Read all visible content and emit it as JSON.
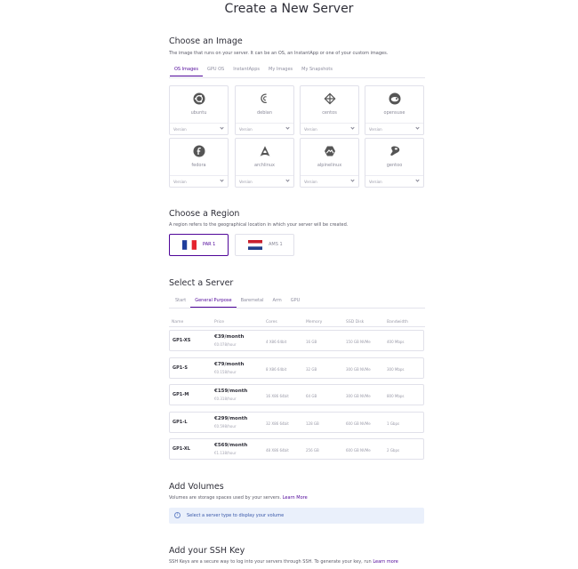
{
  "title": "Create a New Server",
  "image": {
    "heading": "Choose an Image",
    "description": "The image that runs on your server. It can be an OS, an InstantApp or one of your custom images.",
    "tabs": [
      "OS Images",
      "GPU OS",
      "InstantApps",
      "My Images",
      "My Snapshots"
    ],
    "active_tab": "OS Images",
    "os": [
      {
        "name": "ubuntu",
        "version": "Version",
        "icon": "ubuntu-icon"
      },
      {
        "name": "debian",
        "version": "Version",
        "icon": "debian-icon"
      },
      {
        "name": "centos",
        "version": "Version",
        "icon": "centos-icon"
      },
      {
        "name": "opensuse",
        "version": "Version",
        "icon": "opensuse-icon"
      },
      {
        "name": "fedora",
        "version": "Version",
        "icon": "fedora-icon"
      },
      {
        "name": "archlinux",
        "version": "Version",
        "icon": "archlinux-icon"
      },
      {
        "name": "alpinelinux",
        "version": "Version",
        "icon": "alpinelinux-icon"
      },
      {
        "name": "gentoo",
        "version": "Version",
        "icon": "gentoo-icon"
      }
    ]
  },
  "region": {
    "heading": "Choose a Region",
    "description": "A region refers to the geographical location in which your server will be created.",
    "items": [
      {
        "name": "PAR 1",
        "flag": "france-flag",
        "selected": true
      },
      {
        "name": "AMS 1",
        "flag": "netherlands-flag",
        "selected": false
      }
    ]
  },
  "server": {
    "heading": "Select a Server",
    "tabs": [
      "Start",
      "General Purpose",
      "Baremetal",
      "Arm",
      "GPU"
    ],
    "active_tab": "General Purpose",
    "columns": [
      "Name",
      "Price",
      "Cores",
      "Memory",
      "SSD Disk",
      "Bandwidth"
    ],
    "rows": [
      {
        "name": "GP1-XS",
        "price": "€39/month",
        "hourly": "€0.078/hour",
        "cores": "4 X86 64bit",
        "memory": "16 GB",
        "disk": "150 GB NVMe",
        "bandwidth": "400 Mbps"
      },
      {
        "name": "GP1-S",
        "price": "€79/month",
        "hourly": "€0.158/hour",
        "cores": "8 X86 64bit",
        "memory": "32 GB",
        "disk": "300 GB NVMe",
        "bandwidth": "300 Mbps"
      },
      {
        "name": "GP1-M",
        "price": "€159/month",
        "hourly": "€0.318/hour",
        "cores": "16 X86 64bit",
        "memory": "64 GB",
        "disk": "300 GB NVMe",
        "bandwidth": "800 Mbps"
      },
      {
        "name": "GP1-L",
        "price": "€299/month",
        "hourly": "€0.598/hour",
        "cores": "32 X86 64bit",
        "memory": "128 GB",
        "disk": "600 GB NVMe",
        "bandwidth": "1 Gbps"
      },
      {
        "name": "GP1-XL",
        "price": "€569/month",
        "hourly": "€1.138/hour",
        "cores": "48 X86 64bit",
        "memory": "256 GB",
        "disk": "600 GB NVMe",
        "bandwidth": "2 Gbps"
      }
    ]
  },
  "volumes": {
    "heading": "Add Volumes",
    "description": "Volumes are storage spaces used by your servers.",
    "learn_more": "Learn More",
    "info": "Select a server type to display your volume"
  },
  "ssh": {
    "heading": "Add your SSH Key",
    "description": "SSH Keys are a secure way to log into your servers through SSH. To generate your key, run",
    "learn_more": "Learn more"
  },
  "colors": {
    "accent": "#4f0599",
    "info_bg": "#eaf0fb",
    "info_text": "#3756a8"
  }
}
